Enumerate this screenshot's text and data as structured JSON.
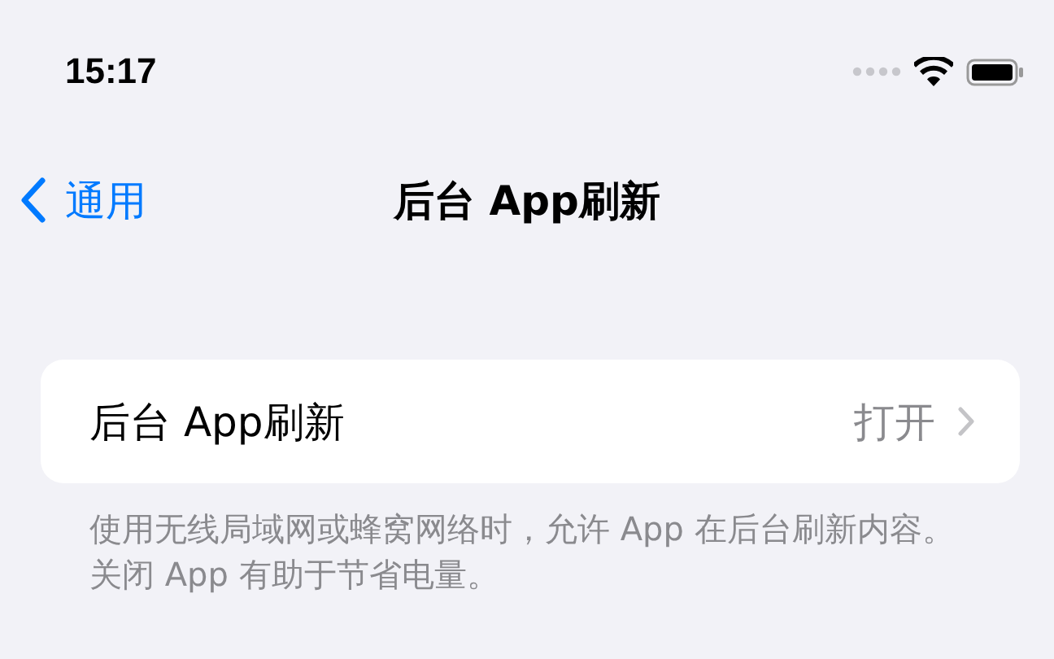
{
  "status_bar": {
    "time": "15:17"
  },
  "nav": {
    "back_label": "通用",
    "title": "后台 App刷新"
  },
  "settings": [
    {
      "label": "后台 App刷新",
      "value": "打开"
    }
  ],
  "footer": "使用无线局域网或蜂窝网络时，允许 App 在后台刷新内容。关闭 App 有助于节省电量。"
}
